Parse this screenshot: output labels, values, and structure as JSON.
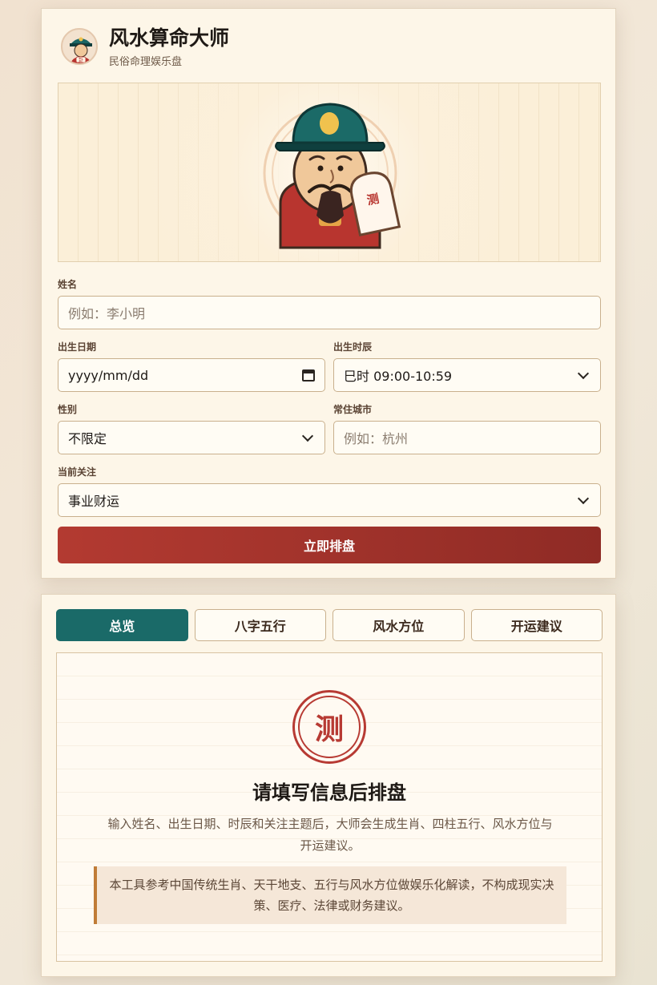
{
  "app": {
    "title": "风水算命大师",
    "subtitle": "民俗命理娱乐盘",
    "banner_seal_char": "测"
  },
  "form": {
    "name_label": "姓名",
    "name_placeholder": "例如：李小明",
    "birth_date_label": "出生日期",
    "birth_date_value": "yyyy/mm/dd",
    "birth_hour_label": "出生时辰",
    "birth_hour_value": "巳时 09:00-10:59",
    "gender_label": "性别",
    "gender_value": "不限定",
    "city_label": "常住城市",
    "city_placeholder": "例如：杭州",
    "focus_label": "当前关注",
    "focus_value": "事业财运",
    "submit_label": "立即排盘"
  },
  "tabs": [
    {
      "label": "总览",
      "active": true
    },
    {
      "label": "八字五行",
      "active": false
    },
    {
      "label": "风水方位",
      "active": false
    },
    {
      "label": "开运建议",
      "active": false
    }
  ],
  "result": {
    "seal_char": "测",
    "empty_title": "请填写信息后排盘",
    "empty_desc": "输入姓名、出生日期、时辰和关注主题后，大师会生成生肖、四柱五行、风水方位与开运建议。",
    "notice": "本工具参考中国传统生肖、天干地支、五行与风水方位做娱乐化解读，不构成现实决策、医疗、法律或财务建议。"
  },
  "colors": {
    "accent_red": "#b33a31",
    "accent_teal": "#1a6a68",
    "card_bg": "#fdf6e8",
    "notice_border": "#c07c37"
  },
  "icons": [
    "master-avatar-icon",
    "fortune-teller-illustration",
    "calendar-icon",
    "chevron-down-icon",
    "seal-icon"
  ]
}
